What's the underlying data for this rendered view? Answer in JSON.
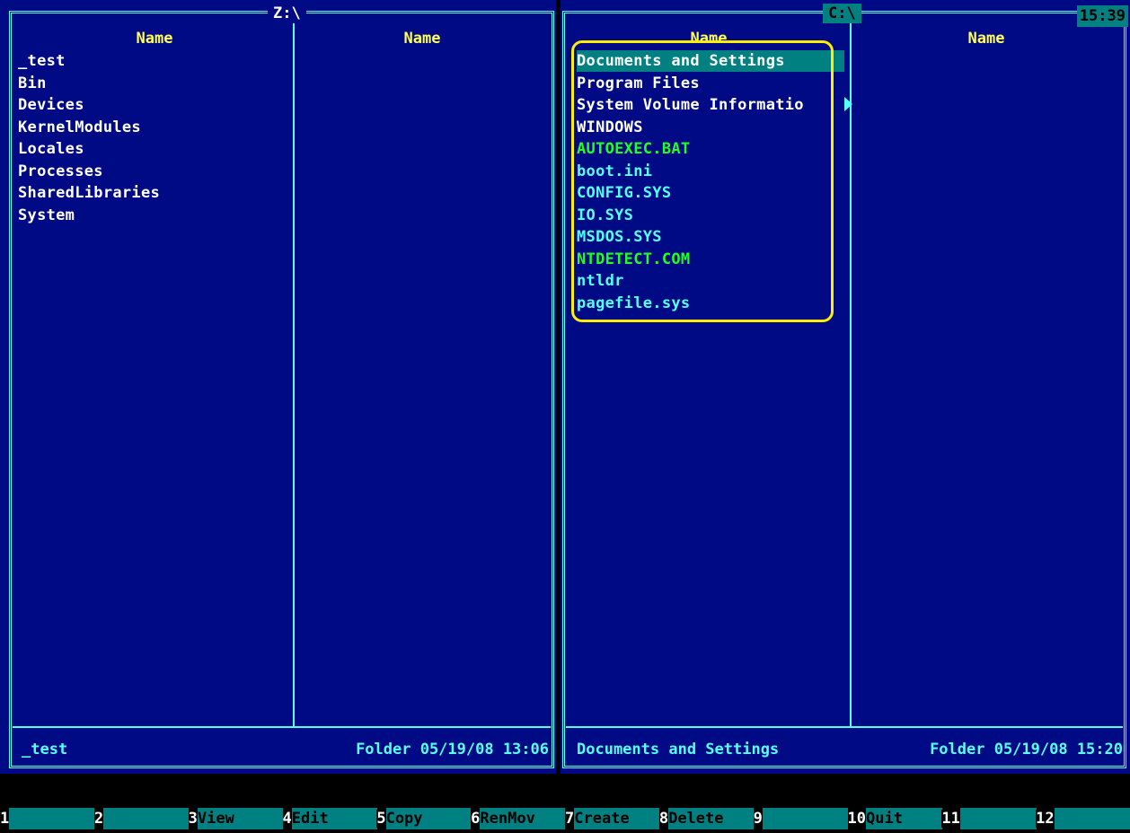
{
  "left_panel": {
    "path": "Z:\\",
    "column_headers": [
      "Name",
      "Name"
    ],
    "files": [
      "_test",
      "Bin",
      "Devices",
      "KernelModules",
      "Locales",
      "Processes",
      "SharedLibraries",
      "System"
    ],
    "status": {
      "name": "_test",
      "info": "Folder 05/19/08 13:06"
    }
  },
  "right_panel": {
    "path": "C:\\",
    "column_headers": [
      "Name",
      "Name"
    ],
    "files": [
      {
        "name": "Documents and Settings",
        "color": "#ffffff",
        "selected": true
      },
      {
        "name": "Program Files",
        "color": "#ffffff",
        "selected": false
      },
      {
        "name": "System Volume Informatio",
        "color": "#ffffff",
        "selected": false
      },
      {
        "name": "WINDOWS",
        "color": "#ffffff",
        "selected": false
      },
      {
        "name": "AUTOEXEC.BAT",
        "color": "#22ff22",
        "selected": false
      },
      {
        "name": "boot.ini",
        "color": "#55ffff",
        "selected": false
      },
      {
        "name": "CONFIG.SYS",
        "color": "#55ffff",
        "selected": false
      },
      {
        "name": "IO.SYS",
        "color": "#55ffff",
        "selected": false
      },
      {
        "name": "MSDOS.SYS",
        "color": "#55ffff",
        "selected": false
      },
      {
        "name": "NTDETECT.COM",
        "color": "#22ff22",
        "selected": false
      },
      {
        "name": "ntldr",
        "color": "#55ffff",
        "selected": false
      },
      {
        "name": "pagefile.sys",
        "color": "#55ffff",
        "selected": false
      }
    ],
    "status": {
      "name": "Documents and Settings",
      "info": "Folder 05/19/08 15:20"
    }
  },
  "clock": "15:39",
  "function_keys": [
    {
      "num": "1",
      "label": ""
    },
    {
      "num": "2",
      "label": ""
    },
    {
      "num": "3",
      "label": "View"
    },
    {
      "num": "4",
      "label": "Edit"
    },
    {
      "num": "5",
      "label": "Copy"
    },
    {
      "num": "6",
      "label": "RenMov"
    },
    {
      "num": "7",
      "label": "Create"
    },
    {
      "num": "8",
      "label": "Delete"
    },
    {
      "num": "9",
      "label": ""
    },
    {
      "num": "10",
      "label": "Quit"
    },
    {
      "num": "11",
      "label": ""
    },
    {
      "num": "12",
      "label": ""
    }
  ],
  "colors": {
    "panel_bg": "#000a84",
    "border": "#55ffff",
    "header": "#ffff55",
    "selection_bg": "#008080",
    "highlight_ring": "#ffee00"
  }
}
